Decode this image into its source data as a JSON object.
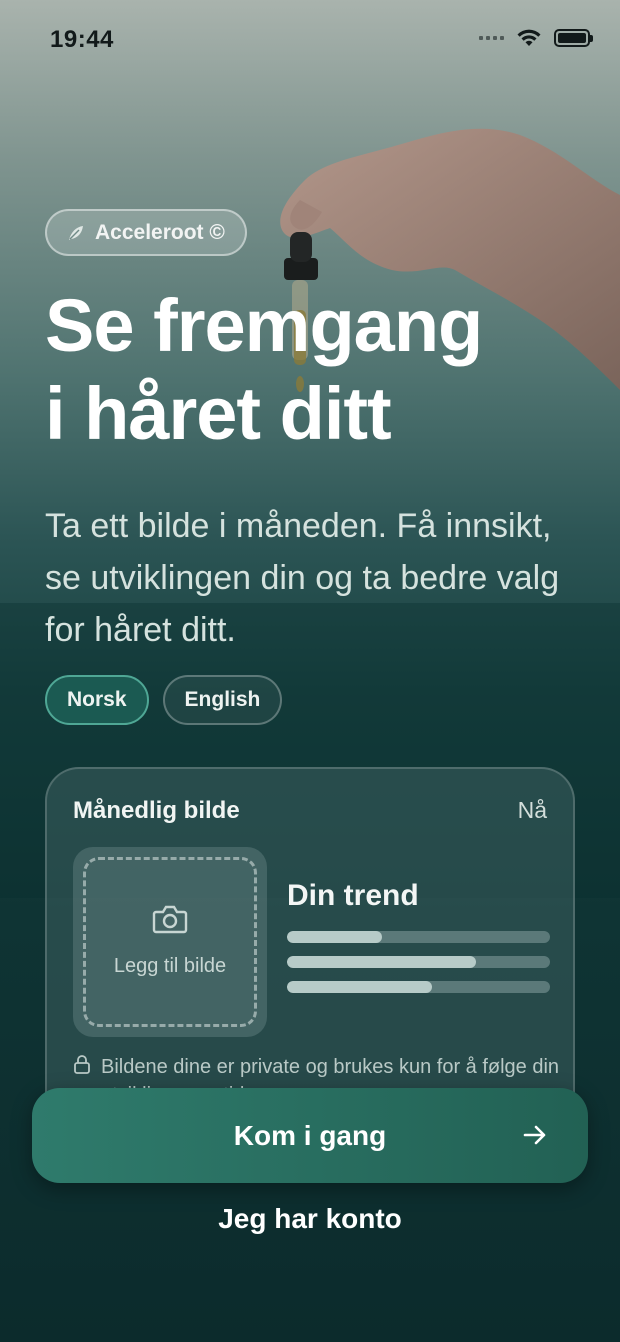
{
  "status_bar": {
    "time": "19:44"
  },
  "brand": {
    "name": "Acceleroot ©",
    "icon": "leaf-icon"
  },
  "hero": {
    "headline_line1": "Se fremgang",
    "headline_line2": "i håret ditt",
    "subtitle": "Ta ett bilde i måneden. Få innsikt, se utviklingen din og ta bedre valg for håret ditt."
  },
  "language": {
    "options": [
      "Norsk",
      "English"
    ],
    "selected": "Norsk"
  },
  "card": {
    "title": "Månedlig bilde",
    "time": "Nå",
    "photo_label": "Legg til bilde",
    "trend_title": "Din trend",
    "trend_levels": [
      0.36,
      0.72,
      0.55
    ],
    "privacy_text": "Bildene dine er private og brukes kun for å følge din utvikling over tid."
  },
  "actions": {
    "primary_label": "Kom i gang",
    "secondary_label": "Jeg har konto"
  },
  "colors": {
    "accent": "#2f7b6c",
    "background": "#0c2b2c"
  }
}
